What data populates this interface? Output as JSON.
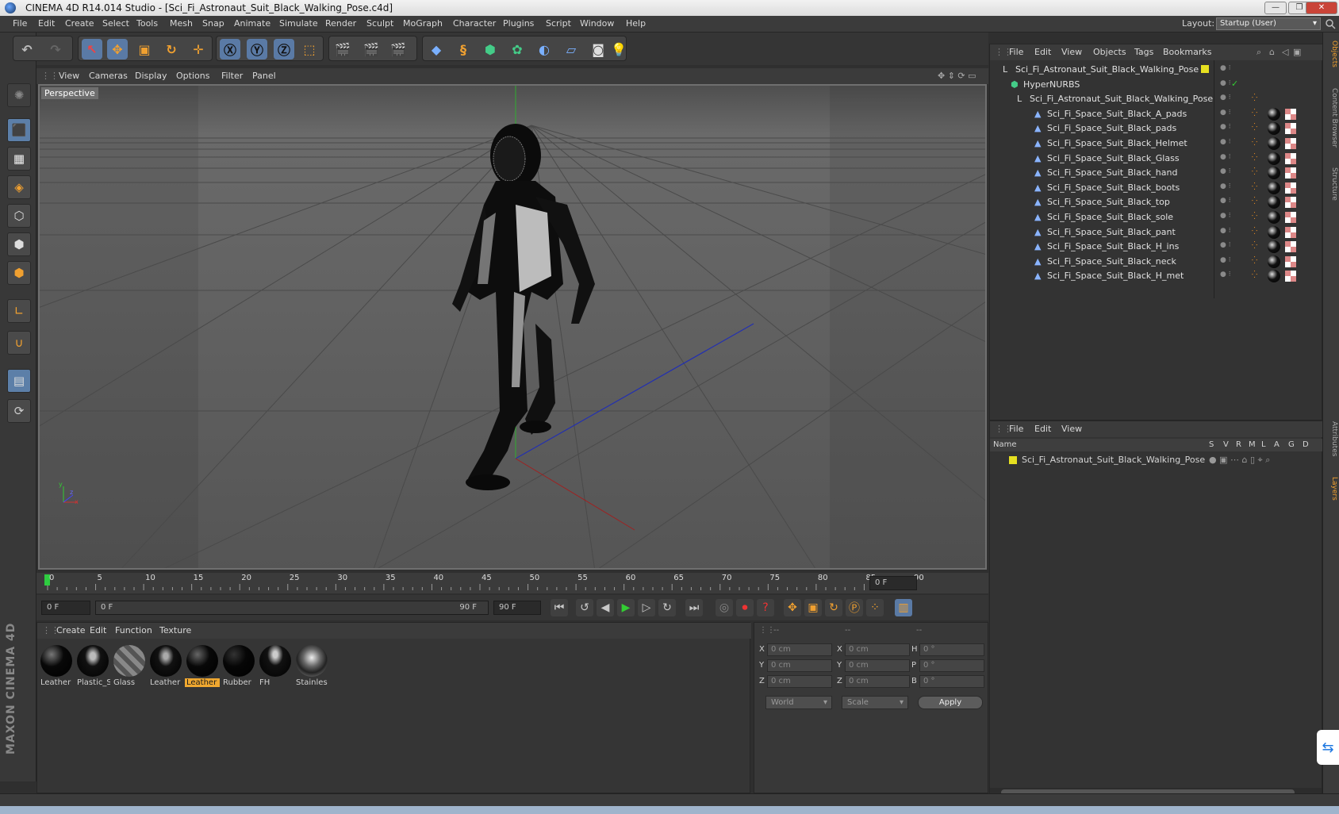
{
  "window": {
    "title": "CINEMA 4D R14.014 Studio - [Sci_Fi_Astronaut_Suit_Black_Walking_Pose.c4d]",
    "controls": [
      "—",
      "❐",
      "✕"
    ]
  },
  "menubar": {
    "items": [
      "File",
      "Edit",
      "Create",
      "Select",
      "Tools",
      "Mesh",
      "Snap",
      "Animate",
      "Simulate",
      "Render",
      "Sculpt",
      "MoGraph",
      "Character",
      "Plugins",
      "Script",
      "Window",
      "Help"
    ],
    "layout_label": "Layout:",
    "layout_value": "Startup (User)"
  },
  "viewport": {
    "menu": [
      "View",
      "Cameras",
      "Display",
      "Options",
      "Filter",
      "Panel"
    ],
    "label": "Perspective",
    "axis_x": "x",
    "axis_y": "y",
    "axis_z": "z"
  },
  "timeline": {
    "ticks": [
      "0",
      "5",
      "10",
      "15",
      "20",
      "25",
      "30",
      "35",
      "40",
      "45",
      "50",
      "55",
      "60",
      "65",
      "70",
      "75",
      "80",
      "85",
      "90"
    ],
    "current_frame": "0 F",
    "start_frame": "0 F",
    "range_start": "0 F",
    "range_end": "90 F",
    "end_frame": "90 F"
  },
  "materials": {
    "menu": [
      "Create",
      "Edit",
      "Function",
      "Texture"
    ],
    "items": [
      {
        "label": "Leather",
        "selected": false
      },
      {
        "label": "Plastic_S",
        "selected": false
      },
      {
        "label": "Glass",
        "selected": false
      },
      {
        "label": "Leather",
        "selected": false
      },
      {
        "label": "Leather",
        "selected": true
      },
      {
        "label": "Rubber",
        "selected": false
      },
      {
        "label": "FH",
        "selected": false
      },
      {
        "label": "Stainles",
        "selected": false
      }
    ]
  },
  "coordinates": {
    "headers": [
      "--",
      "--",
      "--"
    ],
    "rows": [
      {
        "a": "X",
        "av": "0 cm",
        "b": "X",
        "bv": "0 cm",
        "c": "H",
        "cv": "0 °"
      },
      {
        "a": "Y",
        "av": "0 cm",
        "b": "Y",
        "bv": "0 cm",
        "c": "P",
        "cv": "0 °"
      },
      {
        "a": "Z",
        "av": "0 cm",
        "b": "Z",
        "bv": "0 cm",
        "c": "B",
        "cv": "0 °"
      }
    ],
    "space": "World",
    "mode": "Scale",
    "apply": "Apply"
  },
  "objects": {
    "menu": [
      "File",
      "Edit",
      "View",
      "Objects",
      "Tags",
      "Bookmarks"
    ],
    "tree": [
      {
        "name": "Sci_Fi_Astronaut_Suit_Black_Walking_Pose",
        "level": 0,
        "kind": "null"
      },
      {
        "name": "HyperNURBS",
        "level": 1,
        "kind": "nurbs"
      },
      {
        "name": "Sci_Fi_Astronaut_Suit_Black_Walking_Pose",
        "level": 2,
        "kind": "null"
      },
      {
        "name": "Sci_Fi_Space_Suit_Black_A_pads",
        "level": 3,
        "kind": "poly"
      },
      {
        "name": "Sci_Fi_Space_Suit_Black_pads",
        "level": 3,
        "kind": "poly"
      },
      {
        "name": "Sci_Fi_Space_Suit_Black_Helmet",
        "level": 3,
        "kind": "poly"
      },
      {
        "name": "Sci_Fi_Space_Suit_Black_Glass",
        "level": 3,
        "kind": "poly"
      },
      {
        "name": "Sci_Fi_Space_Suit_Black_hand",
        "level": 3,
        "kind": "poly"
      },
      {
        "name": "Sci_Fi_Space_Suit_Black_boots",
        "level": 3,
        "kind": "poly"
      },
      {
        "name": "Sci_Fi_Space_Suit_Black_top",
        "level": 3,
        "kind": "poly"
      },
      {
        "name": "Sci_Fi_Space_Suit_Black_sole",
        "level": 3,
        "kind": "poly"
      },
      {
        "name": "Sci_Fi_Space_Suit_Black_pant",
        "level": 3,
        "kind": "poly"
      },
      {
        "name": "Sci_Fi_Space_Suit_Black_H_ins",
        "level": 3,
        "kind": "poly"
      },
      {
        "name": "Sci_Fi_Space_Suit_Black_neck",
        "level": 3,
        "kind": "poly"
      },
      {
        "name": "Sci_Fi_Space_Suit_Black_H_met",
        "level": 3,
        "kind": "poly"
      }
    ]
  },
  "layers": {
    "menu": [
      "File",
      "Edit",
      "View"
    ],
    "columns": [
      "Name",
      "S",
      "V",
      "R",
      "M",
      "L",
      "A",
      "G",
      "D"
    ],
    "row_name": "Sci_Fi_Astronaut_Suit_Black_Walking_Pose"
  },
  "right_tabs": [
    "Objects",
    "Content Browser",
    "Structure",
    "Attributes",
    "Layers"
  ],
  "brand": "MAXON CINEMA 4D",
  "colors": {
    "accent": "#f0a830",
    "active_tool": "#5a7aa5",
    "layer_color": "#e6e020"
  }
}
